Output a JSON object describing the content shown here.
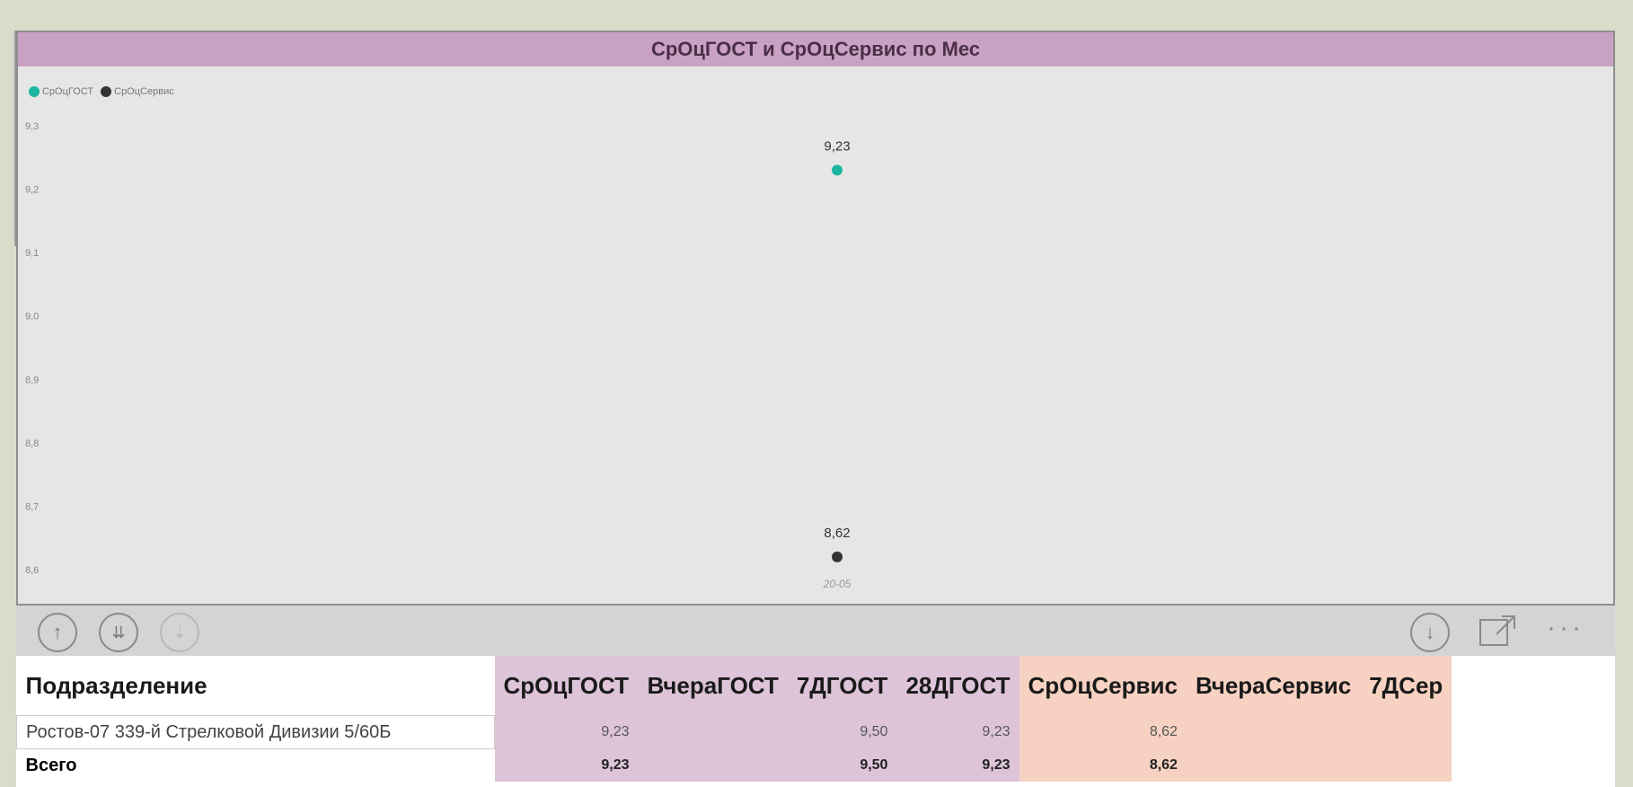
{
  "chart_data": {
    "type": "scatter",
    "title": "СрОцГОСТ и СрОцСервис по Мес",
    "legend_position": "top-left",
    "y_ticks": [
      "9,3",
      "9,2",
      "9,1",
      "9,0",
      "8,9",
      "8,8",
      "8,7",
      "8,6"
    ],
    "ylim": [
      8.6,
      9.3
    ],
    "categories": [
      "20-05"
    ],
    "series": [
      {
        "name": "СрОцГОСТ",
        "color": "#1ab5a0",
        "values": [
          9.23
        ],
        "data_labels": [
          "9,23"
        ]
      },
      {
        "name": "СрОцСервис",
        "color": "#333333",
        "values": [
          8.62
        ],
        "data_labels": [
          "8,62"
        ]
      }
    ]
  },
  "toolbar": {
    "left_icons": [
      "drill-up-icon",
      "expand-all-down-icon",
      "drill-mode-icon"
    ],
    "right_icons": [
      "drill-down-icon",
      "focus-mode-icon",
      "more-options-icon"
    ],
    "more_label": "···"
  },
  "table": {
    "headers": [
      "Подразделение",
      "СрОцГОСТ",
      "ВчераГОСТ",
      "7ДГОСТ",
      "28ДГОСТ",
      "СрОцСервис",
      "ВчераСервис",
      "7ДСер"
    ],
    "rows": [
      [
        "Ростов-07 339-й Стрелковой Дивизии 5/60Б",
        "9,23",
        "",
        "9,50",
        "9,23",
        "8,62",
        "",
        ""
      ]
    ],
    "total": [
      "Всего",
      "9,23",
      "",
      "9,50",
      "9,23",
      "8,62",
      "",
      ""
    ]
  }
}
